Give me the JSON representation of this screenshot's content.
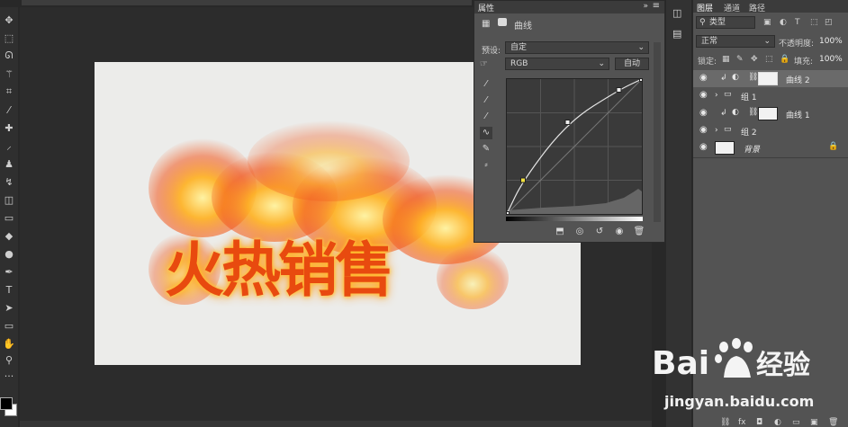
{
  "properties_panel": {
    "tab_label": "属性",
    "adjustment_title": "曲线",
    "preset_label": "预设:",
    "preset_value": "自定",
    "channel_value": "RGB",
    "auto_button": "自动",
    "curve_points": [
      [
        0,
        0
      ],
      [
        0.12,
        0.25
      ],
      [
        0.45,
        0.68
      ],
      [
        0.83,
        0.92
      ],
      [
        1,
        1
      ]
    ]
  },
  "layers_panel": {
    "tabs": [
      "图层",
      "通道",
      "路径"
    ],
    "filter_kind": "类型",
    "blend_mode": "正常",
    "opacity_label": "不透明度:",
    "opacity_value": "100%",
    "lock_label": "锁定:",
    "fill_label": "填充:",
    "fill_value": "100%",
    "layers": [
      {
        "name": "曲线 2",
        "kind": "adjustment",
        "selected": true
      },
      {
        "name": "组 1",
        "kind": "group"
      },
      {
        "name": "曲线 1",
        "kind": "adjustment"
      },
      {
        "name": "组 2",
        "kind": "group"
      },
      {
        "name": "背景",
        "kind": "background",
        "locked": true
      }
    ]
  },
  "canvas": {
    "artwork_text": "火热销售",
    "background_color": "#ececea",
    "text_color": "#e84a0f"
  },
  "watermark": {
    "brand": "Baidu经验",
    "url": "jingyan.baidu.com"
  },
  "toolbar": {
    "icons": [
      "move-icon",
      "marquee-icon",
      "lasso-icon",
      "magic-wand-icon",
      "crop-icon",
      "eyedropper-icon",
      "healing-icon",
      "brush-icon",
      "stamp-icon",
      "history-brush-icon",
      "eraser-icon",
      "gradient-icon",
      "blur-icon",
      "dodge-icon",
      "pen-icon",
      "type-icon",
      "path-select-icon",
      "shape-icon",
      "hand-icon",
      "zoom-icon",
      "more-icon"
    ],
    "foreground_color": "#000000",
    "background_color": "#ffffff"
  }
}
